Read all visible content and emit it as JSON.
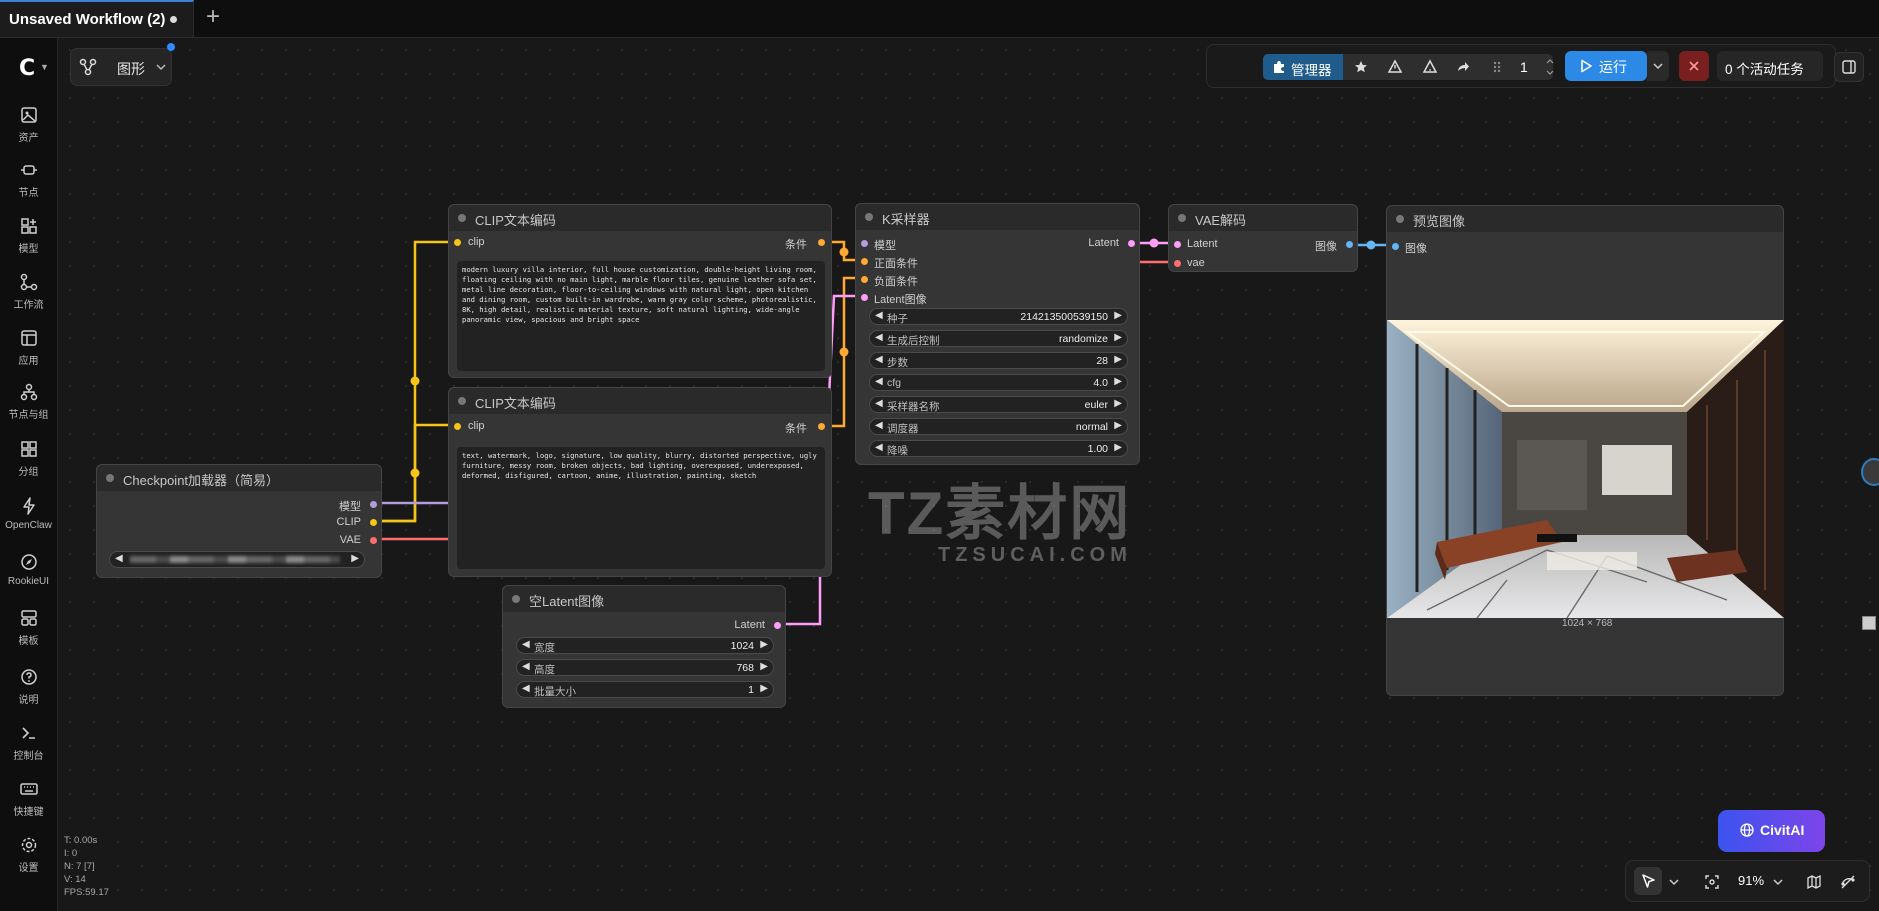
{
  "tab": {
    "title": "Unsaved Workflow (2)",
    "add": "+"
  },
  "sidebar": {
    "logo": "C",
    "items": [
      {
        "label": "资产",
        "icon": "image-icon"
      },
      {
        "label": "节点",
        "icon": "node-icon"
      },
      {
        "label": "模型",
        "icon": "model-icon"
      },
      {
        "label": "工作流",
        "icon": "workflow-icon"
      },
      {
        "label": "应用",
        "icon": "app-icon"
      },
      {
        "label": "节点与组",
        "icon": "node-group-icon"
      },
      {
        "label": "分组",
        "icon": "group-icon"
      },
      {
        "label": "OpenClaw",
        "icon": "openclaw-icon"
      },
      {
        "label": "RookieUI",
        "icon": "rookieui-icon"
      },
      {
        "label": "模板",
        "icon": "template-icon"
      },
      {
        "label": "说明",
        "icon": "help-icon"
      },
      {
        "label": "控制台",
        "icon": "console-icon"
      },
      {
        "label": "快捷键",
        "icon": "keyboard-icon"
      },
      {
        "label": "设置",
        "icon": "settings-icon"
      }
    ]
  },
  "stats": {
    "t": "T: 0.00s",
    "i": "I: 0",
    "n": "N: 7 [7]",
    "v": "V: 14",
    "fps": "FPS:59.17"
  },
  "graph": {
    "label": "图形"
  },
  "toolbar": {
    "manager": "管理器",
    "queue_count": "1",
    "run": "运行",
    "active_jobs": "0 个活动任务"
  },
  "nodes": {
    "clip1": {
      "title": "CLIP文本编码",
      "input": "clip",
      "output": "条件",
      "text": "modern luxury villa interior, full house customization, double-height living room, floating ceiling with no main light, marble floor tiles, genuine leather sofa set, metal line decoration, floor-to-ceiling windows with natural light, open kitchen and dining room, custom built-in wardrobe, warm gray color scheme, photorealistic, 8K, high detail, realistic material texture, soft natural lighting, wide-angle panoramic view, spacious and bright space"
    },
    "clip2": {
      "title": "CLIP文本编码",
      "input": "clip",
      "output": "条件",
      "text": "text, watermark, logo, signature, low quality, blurry, distorted perspective, ugly furniture, messy room, broken objects, bad lighting, overexposed, underexposed, deformed, disfigured, cartoon, anime, illustration, painting, sketch"
    },
    "checkpoint": {
      "title": "Checkpoint加载器（简易）",
      "outputs": [
        "模型",
        "CLIP",
        "VAE"
      ]
    },
    "ksampler": {
      "title": "K采样器",
      "inputs": [
        "模型",
        "正面条件",
        "负面条件",
        "Latent图像"
      ],
      "output": "Latent",
      "widgets": [
        {
          "label": "种子",
          "value": "214213500539150"
        },
        {
          "label": "生成后控制",
          "value": "randomize"
        },
        {
          "label": "步数",
          "value": "28"
        },
        {
          "label": "cfg",
          "value": "4.0"
        },
        {
          "label": "采样器名称",
          "value": "euler"
        },
        {
          "label": "调度器",
          "value": "normal"
        },
        {
          "label": "降噪",
          "value": "1.00"
        }
      ]
    },
    "vae": {
      "title": "VAE解码",
      "inputs": [
        "Latent",
        "vae"
      ],
      "output": "图像"
    },
    "preview": {
      "title": "预览图像",
      "input": "图像",
      "caption": "1024 × 768"
    },
    "latent": {
      "title": "空Latent图像",
      "output": "Latent",
      "widgets": [
        {
          "label": "宽度",
          "value": "1024"
        },
        {
          "label": "高度",
          "value": "768"
        },
        {
          "label": "批量大小",
          "value": "1"
        }
      ]
    }
  },
  "watermark": {
    "main": "TZ素材网",
    "sub": "TZSUCAI.COM"
  },
  "civitai": {
    "label": "CivitAI"
  },
  "bottom": {
    "zoom": "91%"
  },
  "colors": {
    "clip": "#f5c518",
    "model": "#b39ddb",
    "vae": "#ff6e6e",
    "conditioning": "#ffa931",
    "latent": "#ff9cf9",
    "image": "#64b5f6",
    "run": "#2c8ae6",
    "civitai": "#5a4bea"
  }
}
